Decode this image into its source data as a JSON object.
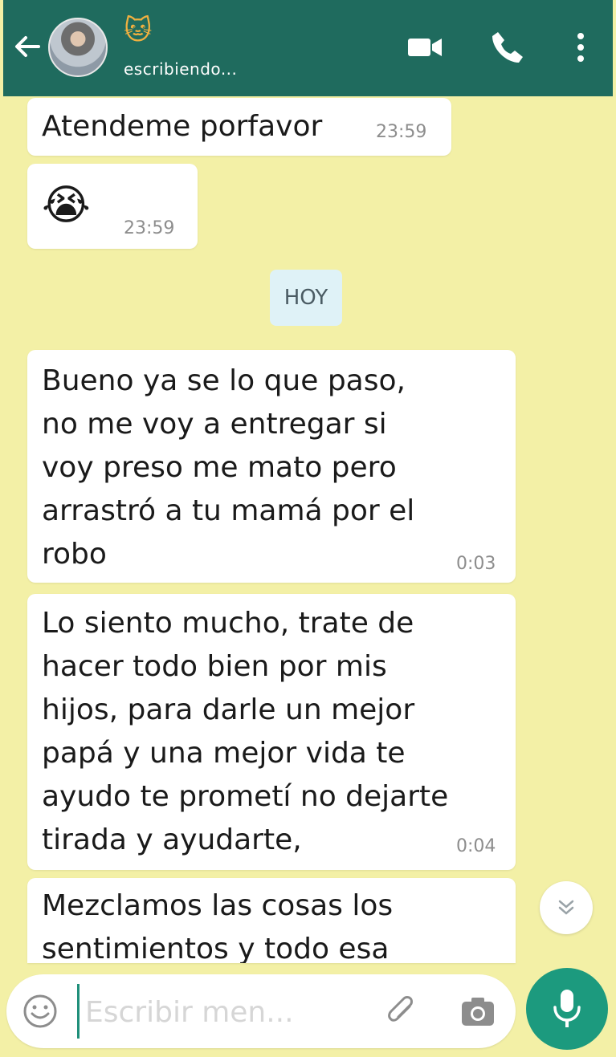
{
  "header": {
    "contact_name_emoji": "🐱",
    "status": "escribiendo..."
  },
  "messages": [
    {
      "text": "Atendeme porfavor",
      "time": "23:59"
    },
    {
      "text": "😭",
      "time": "23:59"
    },
    {
      "text": "Bueno ya se lo que paso,\nno me voy a entregar si\nvoy preso me mato pero\narrastró a tu mamá por el\nrobo",
      "time": "0:03"
    },
    {
      "text": "Lo siento mucho, trate de\nhacer todo bien por mis\nhijos, para darle un mejor\npapá y una mejor vida te\nayudo te prometí no dejarte\ntirada y ayudarte,",
      "time": "0:04"
    },
    {
      "text": "Mezclamos las cosas los\nsentimientos y todo esa",
      "time": ""
    }
  ],
  "day_divider": "HOY",
  "composer": {
    "placeholder": "Escribir men..."
  },
  "colors": {
    "header": "#1f6b5e",
    "background": "#f3f0a6",
    "accent": "#1c9a7e"
  }
}
